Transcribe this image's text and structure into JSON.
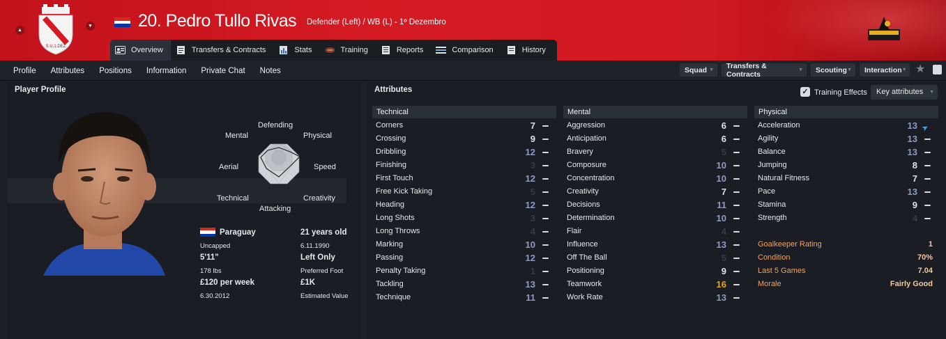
{
  "header": {
    "title": "20. Pedro Tullo Rivas",
    "subtitle": "Defender (Left) / WB (L) - 1º Dezembro",
    "tabs": [
      {
        "label": "Overview",
        "icon": "profile-card-icon",
        "active": true
      },
      {
        "label": "Transfers & Contracts",
        "icon": "document-icon"
      },
      {
        "label": "Stats",
        "icon": "bar-chart-icon"
      },
      {
        "label": "Training",
        "icon": "football-icon"
      },
      {
        "label": "Reports",
        "icon": "report-icon"
      },
      {
        "label": "Comparison",
        "icon": "comparison-icon"
      },
      {
        "label": "History",
        "icon": "history-icon"
      }
    ],
    "colors": {
      "banner": "#d01820",
      "banner_dark": "#a50d14"
    }
  },
  "subnav": {
    "links": [
      "Profile",
      "Attributes",
      "Positions",
      "Information",
      "Private Chat",
      "Notes"
    ],
    "dropdowns": [
      "Squad",
      "Transfers & Contracts",
      "Scouting",
      "Interaction"
    ]
  },
  "profile": {
    "title": "Player Profile",
    "radar_labels": {
      "defending": "Defending",
      "physical": "Physical",
      "speed": "Speed",
      "creativity": "Creativity",
      "attacking": "Attacking",
      "technical": "Technical",
      "aerial": "Aerial",
      "mental": "Mental"
    },
    "nationality": "Paraguay",
    "caps": "Uncapped",
    "age": "21 years old",
    "dob": "6.11.1990",
    "height": "5'11\"",
    "weight": "178 lbs",
    "foot": "Left Only",
    "foot_label": "Preferred Foot",
    "wage": "£120 per week",
    "contract_end": "6.30.2012",
    "value": "£1K",
    "value_label": "Estimated Value"
  },
  "attributes": {
    "title": "Attributes",
    "training_effects_label": "Training Effects",
    "key_attributes_label": "Key attributes",
    "technical": {
      "heading": "Technical",
      "rows": [
        {
          "name": "Corners",
          "value": "7",
          "tone": "high"
        },
        {
          "name": "Crossing",
          "value": "9",
          "tone": "high"
        },
        {
          "name": "Dribbling",
          "value": "12",
          "tone": "blue"
        },
        {
          "name": "Finishing",
          "value": "3",
          "tone": "dim"
        },
        {
          "name": "First Touch",
          "value": "12",
          "tone": "blue"
        },
        {
          "name": "Free Kick Taking",
          "value": "5",
          "tone": "dim"
        },
        {
          "name": "Heading",
          "value": "12",
          "tone": "blue"
        },
        {
          "name": "Long Shots",
          "value": "3",
          "tone": "dim"
        },
        {
          "name": "Long Throws",
          "value": "4",
          "tone": "dim"
        },
        {
          "name": "Marking",
          "value": "10",
          "tone": "blue"
        },
        {
          "name": "Passing",
          "value": "12",
          "tone": "blue"
        },
        {
          "name": "Penalty Taking",
          "value": "1",
          "tone": "dim"
        },
        {
          "name": "Tackling",
          "value": "13",
          "tone": "blue"
        },
        {
          "name": "Technique",
          "value": "11",
          "tone": "blue"
        }
      ]
    },
    "mental": {
      "heading": "Mental",
      "rows": [
        {
          "name": "Aggression",
          "value": "6",
          "tone": "high"
        },
        {
          "name": "Anticipation",
          "value": "6",
          "tone": "high"
        },
        {
          "name": "Bravery",
          "value": "5",
          "tone": "dim"
        },
        {
          "name": "Composure",
          "value": "10",
          "tone": "blue"
        },
        {
          "name": "Concentration",
          "value": "10",
          "tone": "blue"
        },
        {
          "name": "Creativity",
          "value": "7",
          "tone": "high"
        },
        {
          "name": "Decisions",
          "value": "11",
          "tone": "blue"
        },
        {
          "name": "Determination",
          "value": "10",
          "tone": "blue"
        },
        {
          "name": "Flair",
          "value": "4",
          "tone": "dim"
        },
        {
          "name": "Influence",
          "value": "13",
          "tone": "blue"
        },
        {
          "name": "Off The Ball",
          "value": "5",
          "tone": "dim"
        },
        {
          "name": "Positioning",
          "value": "9",
          "tone": "high"
        },
        {
          "name": "Teamwork",
          "value": "16",
          "tone": "gold"
        },
        {
          "name": "Work Rate",
          "value": "13",
          "tone": "blue"
        }
      ]
    },
    "physical": {
      "heading": "Physical",
      "rows": [
        {
          "name": "Acceleration",
          "value": "13",
          "tone": "blue",
          "trend": "up"
        },
        {
          "name": "Agility",
          "value": "13",
          "tone": "blue"
        },
        {
          "name": "Balance",
          "value": "13",
          "tone": "blue"
        },
        {
          "name": "Jumping",
          "value": "8",
          "tone": "high"
        },
        {
          "name": "Natural Fitness",
          "value": "7",
          "tone": "high"
        },
        {
          "name": "Pace",
          "value": "13",
          "tone": "blue"
        },
        {
          "name": "Stamina",
          "value": "9",
          "tone": "high"
        },
        {
          "name": "Strength",
          "value": "4",
          "tone": "dim"
        }
      ]
    },
    "summary": [
      {
        "name": "Goalkeeper Rating",
        "value": "1"
      },
      {
        "name": "Condition",
        "value": "70%"
      },
      {
        "name": "Last 5 Games",
        "value": "7.04"
      },
      {
        "name": "Morale",
        "value": "Fairly Good"
      }
    ]
  }
}
